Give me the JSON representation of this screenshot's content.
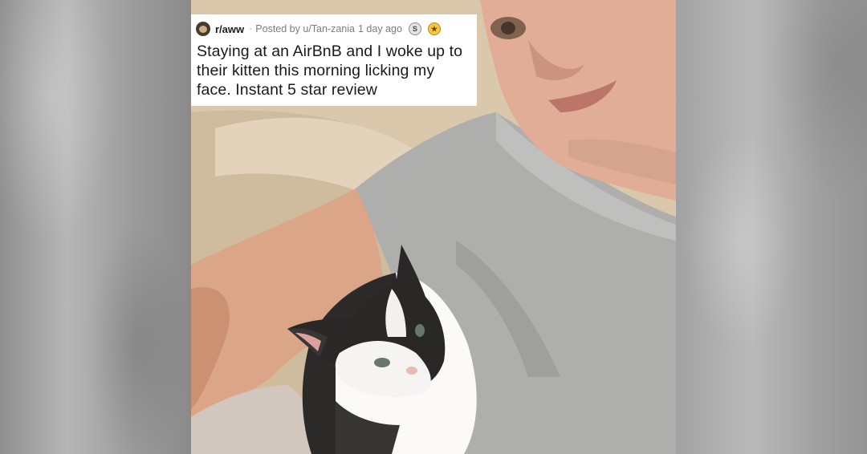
{
  "post": {
    "subreddit": "r/aww",
    "posted_by": "Posted by u/Tan-zania",
    "age": "1 day ago",
    "title": "Staying at an AirBnB and I woke up to their kitten this morning licking my face. Instant 5 star review"
  },
  "awards": [
    {
      "icon": "silver-award-icon",
      "glyph": "S",
      "color": "#e4e4e4"
    },
    {
      "icon": "gold-award-icon",
      "glyph": "★",
      "color": "#f7c741"
    }
  ],
  "colors": {
    "card_bg": "#ffffff",
    "title_text": "#1a1a1b",
    "meta_text": "#7c7c7c"
  }
}
